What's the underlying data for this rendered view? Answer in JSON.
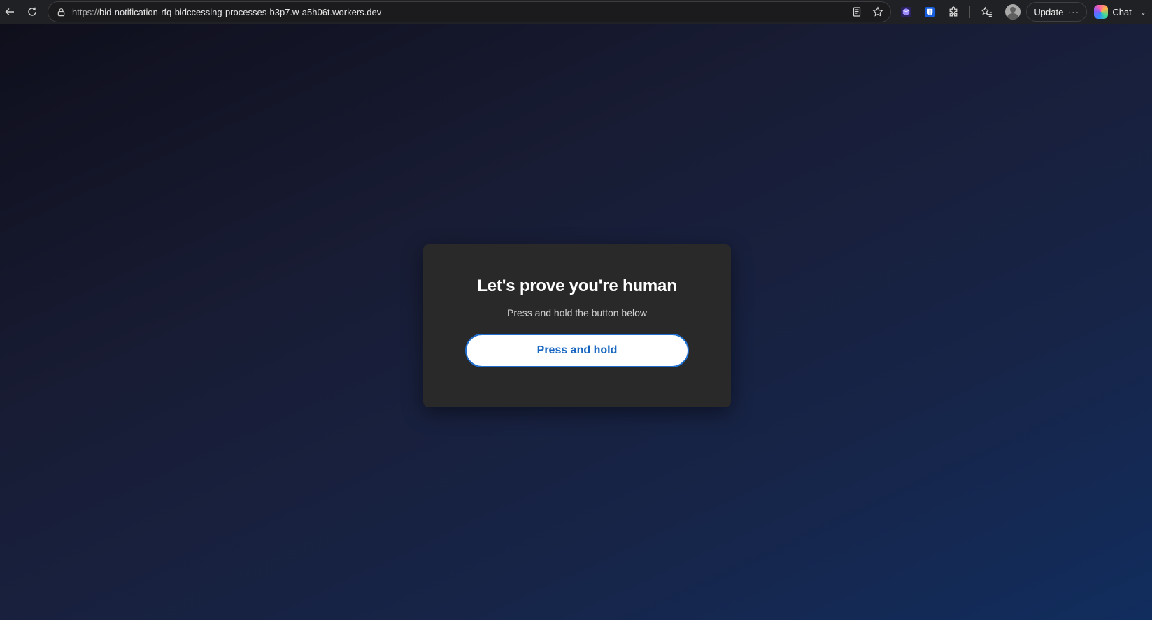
{
  "browser": {
    "url_scheme": "https://",
    "url_rest": "bid-notification-rfq-bidccessing-processes-b3p7.w-a5h06t.workers.dev",
    "update_label": "Update",
    "update_more": "···",
    "chat_label": "Chat"
  },
  "challenge": {
    "title": "Let's prove you're human",
    "subtitle": "Press and hold the button below",
    "button_label": "Press and hold"
  },
  "colors": {
    "card_bg": "#292929",
    "button_text": "#1565c0",
    "button_border": "#1f6fd1",
    "page_gradient_start": "#0f0f1c",
    "page_gradient_end": "#112d5e"
  }
}
